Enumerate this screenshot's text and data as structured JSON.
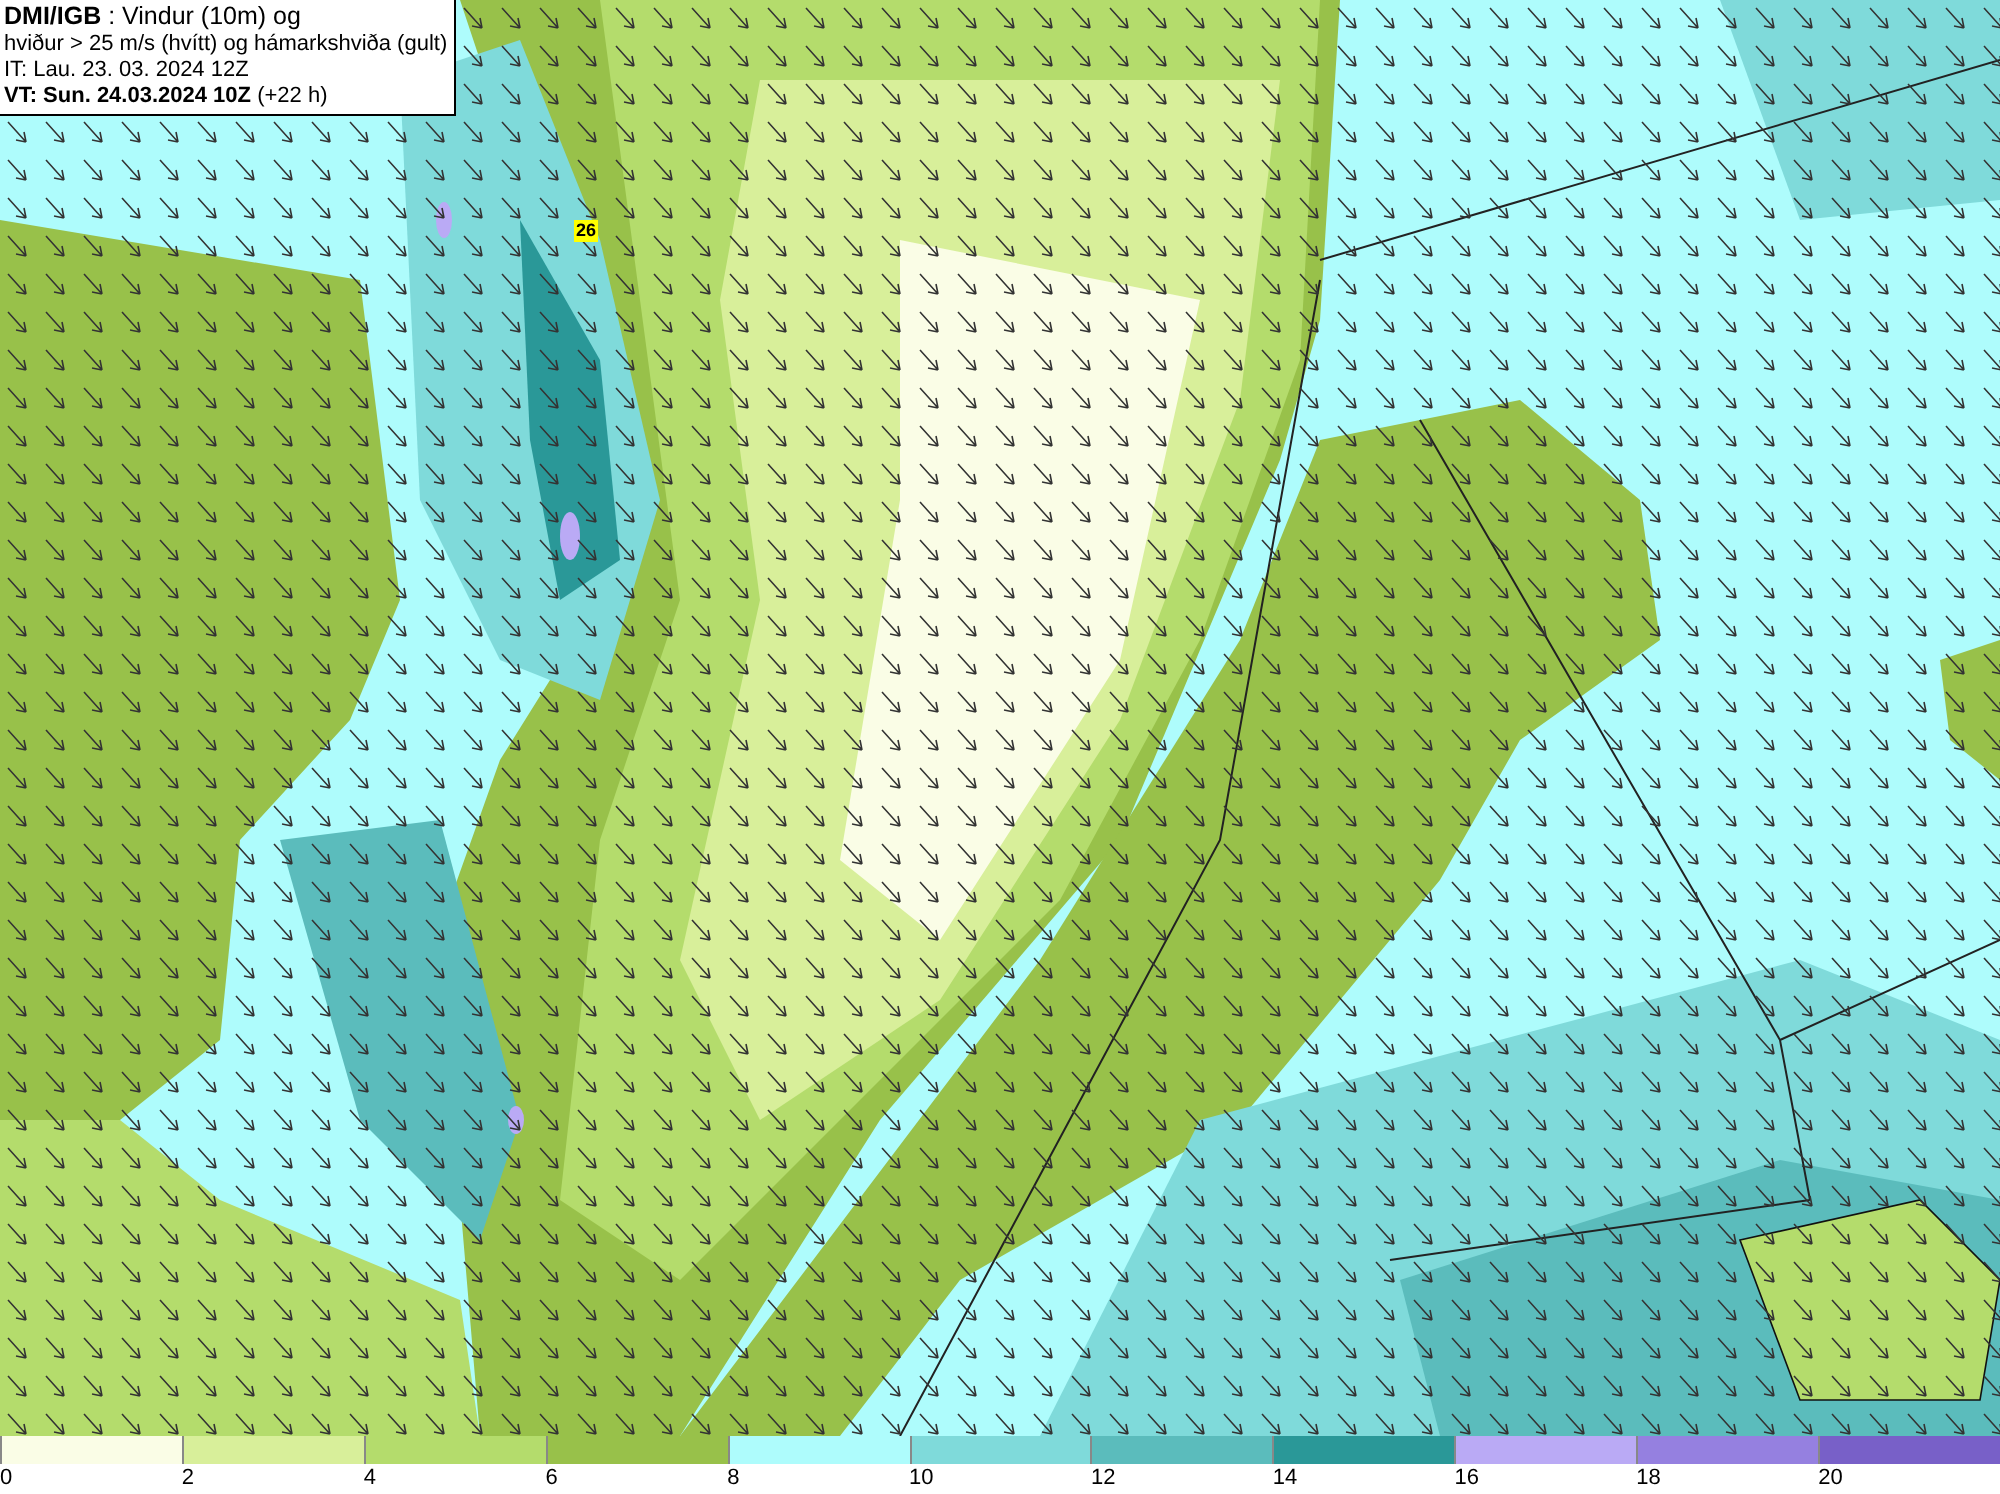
{
  "title_box": {
    "lines": [
      "**DMI/IGB** : Vindur (10m) og",
      "hviður > 25 m/s (hvítt) og hámarkshviða (gult)",
      "IT: Lau. 23. 03. 2024 12Z",
      "**VT: Sun. 24.03.2024 10Z** (+22 h)"
    ]
  },
  "map": {
    "max_gust_label": "26"
  },
  "legend": [
    {
      "label": "0",
      "color": "#fafde6"
    },
    {
      "label": "2",
      "color": "#d8ef9a"
    },
    {
      "label": "4",
      "color": "#b4dc6c"
    },
    {
      "label": "6",
      "color": "#98c14a"
    },
    {
      "label": "8",
      "color": "#aefcfc"
    },
    {
      "label": "10",
      "color": "#7fdada"
    },
    {
      "label": "12",
      "color": "#5bbcbc"
    },
    {
      "label": "14",
      "color": "#2a9898"
    },
    {
      "label": "16",
      "color": "#baaaf5"
    },
    {
      "label": "18",
      "color": "#9580e0"
    },
    {
      "label": "20",
      "color": "#7860c8"
    }
  ]
}
